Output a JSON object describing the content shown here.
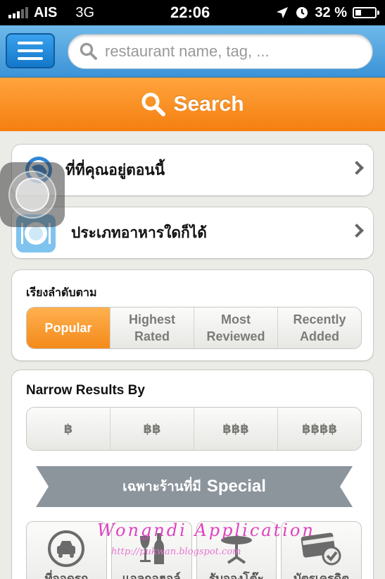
{
  "status_bar": {
    "carrier": "AIS",
    "network": "3G",
    "time": "22:06",
    "battery": "32 %",
    "battery_level": 0.32
  },
  "header": {
    "search_placeholder": "restaurant name, tag, ...",
    "search_button": "Search"
  },
  "quick_links": [
    {
      "label": "ที่ที่คุณอยู่ตอนนี้",
      "icon": "location-globe-icon"
    },
    {
      "label": "ประเภทอาหารใดก็ได้",
      "icon": "plate-icon"
    }
  ],
  "sort": {
    "title": "เรียงลำดับตาม",
    "options": [
      {
        "line1": "Popular",
        "line2": "",
        "active": true
      },
      {
        "line1": "Highest",
        "line2": "Rated",
        "active": false
      },
      {
        "line1": "Most",
        "line2": "Reviewed",
        "active": false
      },
      {
        "line1": "Recently",
        "line2": "Added",
        "active": false
      }
    ]
  },
  "narrow": {
    "title": "Narrow Results By",
    "price_levels": [
      "฿",
      "฿฿",
      "฿฿฿",
      "฿฿฿฿"
    ],
    "special_th": "เฉพาะร้านที่มี",
    "special_en": "Special",
    "features": [
      {
        "label": "ที่จอดรถ",
        "icon": "car-parking-icon"
      },
      {
        "label": "แอลกอฮอล์",
        "icon": "wine-bottle-icon"
      },
      {
        "label": "รับจองโต๊ะ",
        "icon": "table-reservation-icon"
      },
      {
        "label": "บัตรเครดิต",
        "icon": "credit-card-icon"
      }
    ]
  },
  "watermark": {
    "title": "Wongndi Application",
    "url": "http://pukwan.blogspot.com"
  },
  "colors": {
    "accent_orange": "#f47f10",
    "header_blue": "#3b93d6"
  }
}
